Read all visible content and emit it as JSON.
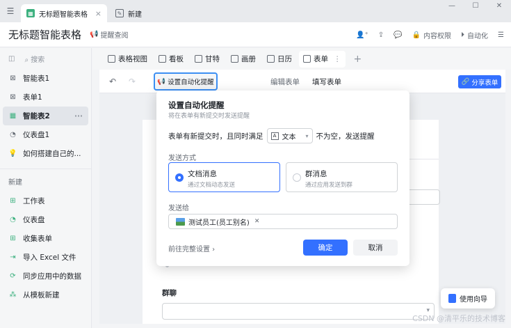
{
  "tabstrip": {
    "tabs": [
      {
        "label": "无标题智能表格",
        "active": true
      },
      {
        "label": "新建",
        "active": false
      }
    ],
    "close": "×"
  },
  "window": {
    "minimize": "—",
    "maximize": "☐",
    "close": "✕"
  },
  "header": {
    "title": "无标题智能表格",
    "remind": "提醒查阅",
    "permissions": "内容权限",
    "automation": "自动化"
  },
  "sidebar": {
    "search": "搜索",
    "items": [
      {
        "label": "智能表1"
      },
      {
        "label": "表单1"
      },
      {
        "label": "智能表2"
      },
      {
        "label": "仪表盘1"
      },
      {
        "label": "如何搭建自己的..."
      }
    ],
    "more": "···",
    "new_section": "新建",
    "new_items": [
      {
        "label": "工作表"
      },
      {
        "label": "仪表盘"
      },
      {
        "label": "收集表单"
      },
      {
        "label": "导入 Excel 文件"
      },
      {
        "label": "同步应用中的数据"
      },
      {
        "label": "从模板新建"
      }
    ]
  },
  "viewbar": {
    "tabs": [
      {
        "label": "表格视图"
      },
      {
        "label": "看板"
      },
      {
        "label": "甘特"
      },
      {
        "label": "画册"
      },
      {
        "label": "日历"
      },
      {
        "label": "表单"
      }
    ],
    "sep": "⋮",
    "plus": "+"
  },
  "editor": {
    "remind_button": "设置自动化提醒",
    "tab_edit": "编辑表单",
    "tab_fill": "填写表单",
    "share": "分享表单",
    "group_label": "群聊"
  },
  "popup": {
    "title": "设置自动化提醒",
    "subtitle": "将在表单有新提交时发送提醒",
    "cond_prefix": "表单有新提交时，且同时满足",
    "field": "文本",
    "cond_suffix": "不为空，发送提醒",
    "send_method_label": "发送方式",
    "options": [
      {
        "title": "文档消息",
        "desc": "通过文档动态发送",
        "selected": true
      },
      {
        "title": "群消息",
        "desc": "通过应用发送到群",
        "selected": false
      }
    ],
    "send_to_label": "发送给",
    "recipient": "测试员工(员工别名)",
    "advanced": "前往完整设置 ›",
    "ok": "确定",
    "cancel": "取消"
  },
  "guide": "使用向导",
  "watermark": "CSDN @清平乐的技术博客",
  "colors": {
    "accent": "#3370ff",
    "highlight": "#3c8ff3",
    "green": "#3bb07e"
  }
}
